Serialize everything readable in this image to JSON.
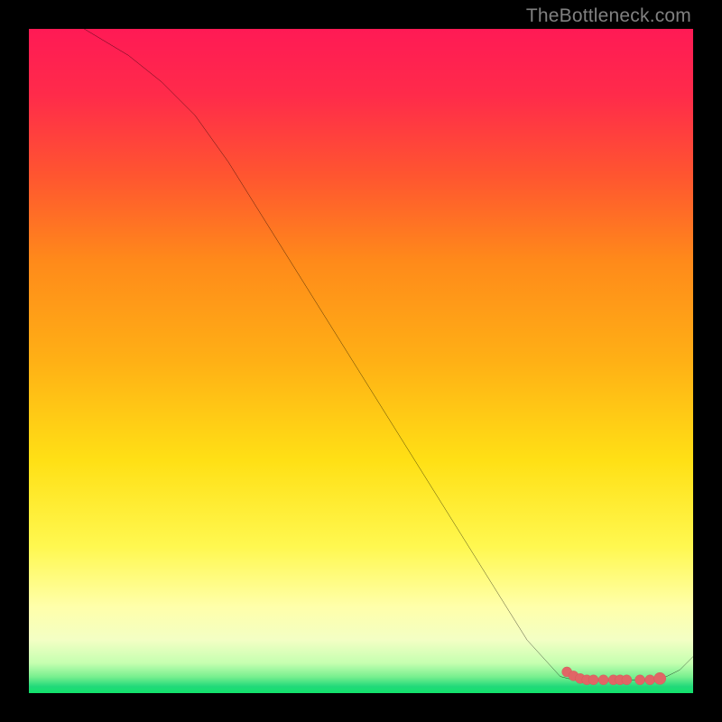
{
  "watermark": "TheBottleneck.com",
  "colors": {
    "frame": "#000000",
    "gradient_top": "#ff1a4d",
    "gradient_upper_mid": "#ff8a1a",
    "gradient_mid": "#ffe015",
    "gradient_pale": "#ffffaa",
    "gradient_bottom": "#11e26a",
    "curve_stroke": "#000000",
    "marker_fill": "#e06666",
    "watermark_text": "#808080"
  },
  "chart_data": {
    "type": "line",
    "title": "",
    "xlabel": "",
    "ylabel": "",
    "xlim": [
      0,
      100
    ],
    "ylim": [
      0,
      100
    ],
    "grid": false,
    "legend": false,
    "series": [
      {
        "name": "bottleneck-curve",
        "x": [
          0,
          5,
          10,
          15,
          20,
          25,
          30,
          35,
          40,
          45,
          50,
          55,
          60,
          65,
          70,
          75,
          80,
          82,
          84,
          86,
          88,
          90,
          92,
          94,
          96,
          98,
          100
        ],
        "values": [
          105,
          102,
          99,
          96,
          92,
          87,
          80,
          72,
          64,
          56,
          48,
          40,
          32,
          24,
          16,
          8,
          2.5,
          2,
          2,
          2,
          2,
          2,
          2,
          2,
          2.5,
          3.5,
          5.5
        ]
      }
    ],
    "markers": [
      {
        "series": "optimal-region",
        "x": 81,
        "y": 3.2
      },
      {
        "series": "optimal-region",
        "x": 82,
        "y": 2.6
      },
      {
        "series": "optimal-region",
        "x": 83,
        "y": 2.2
      },
      {
        "series": "optimal-region",
        "x": 84,
        "y": 2.0
      },
      {
        "series": "optimal-region",
        "x": 85,
        "y": 2.0
      },
      {
        "series": "optimal-region",
        "x": 86.5,
        "y": 2.0
      },
      {
        "series": "optimal-region",
        "x": 88,
        "y": 2.0
      },
      {
        "series": "optimal-region",
        "x": 89,
        "y": 2.0
      },
      {
        "series": "optimal-region",
        "x": 90,
        "y": 2.0
      },
      {
        "series": "optimal-region",
        "x": 92,
        "y": 2.0
      },
      {
        "series": "optimal-region",
        "x": 93.5,
        "y": 2.0
      },
      {
        "series": "optimal-region",
        "x": 95,
        "y": 2.2
      }
    ]
  }
}
